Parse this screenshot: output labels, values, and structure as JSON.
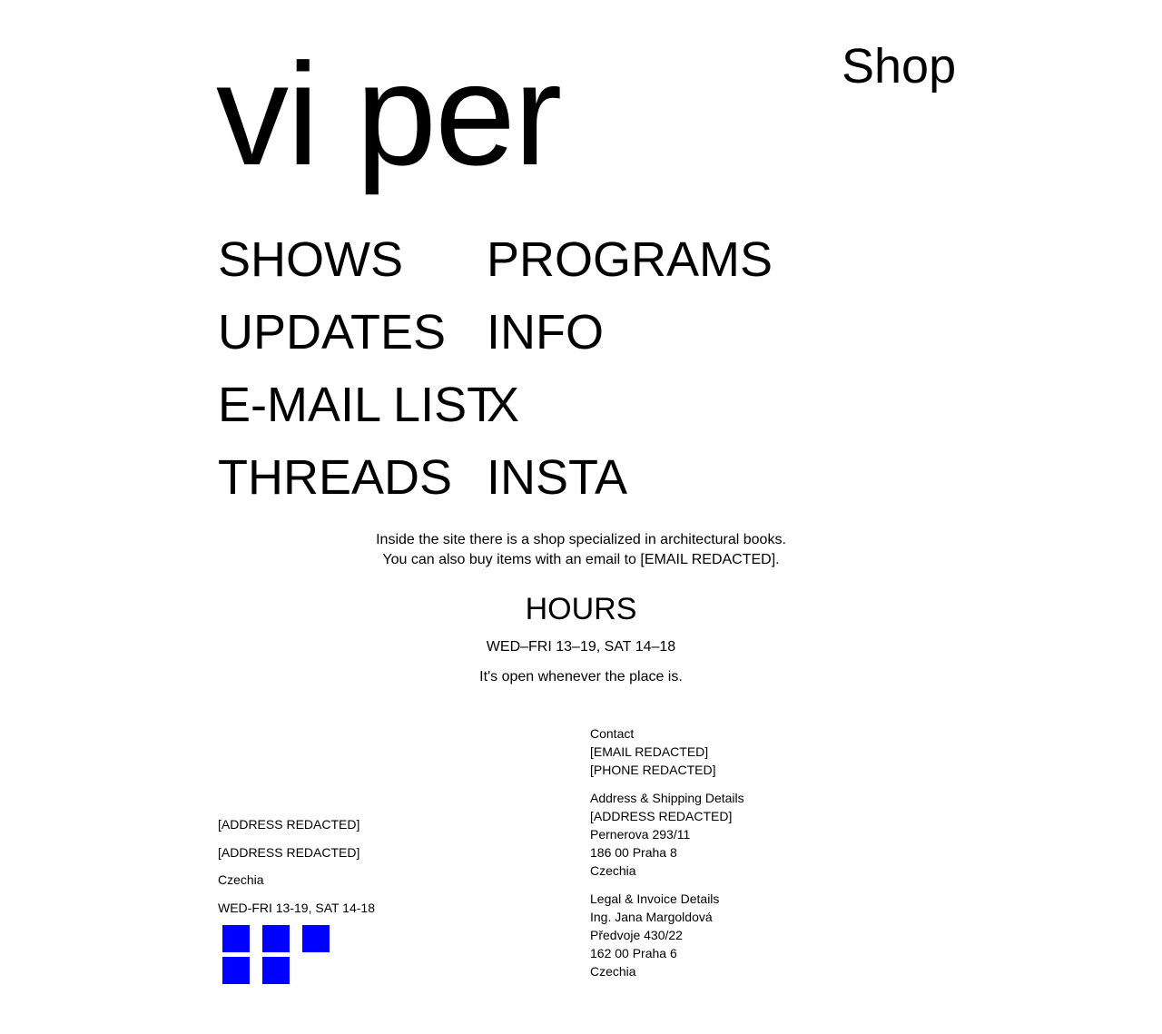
{
  "header": {
    "logo": "vi per",
    "shop_label": "Shop"
  },
  "nav": {
    "items": [
      "SHOWS",
      "PROGRAMS",
      "UPDATES",
      "INFO",
      "E-MAIL LIST",
      "X",
      "THREADS",
      "INSTA"
    ]
  },
  "intro": {
    "line1": "Inside the site there is a shop specialized in architectural books.",
    "line2": "You can also buy items with an email to [EMAIL REDACTED]."
  },
  "hours": {
    "title": "HOURS",
    "times": "WED–FRI 13–19, SAT 14–18",
    "note": "It's open whenever the place is."
  },
  "footer_left": {
    "lines": [
      "[ADDRESS REDACTED]",
      "[ADDRESS REDACTED]",
      "Czechia",
      "WED-FRI 13-19, SAT 14-18"
    ],
    "icon_color": "#0000ff",
    "icons": [
      "social-icon-1",
      "social-icon-2",
      "social-icon-3",
      "social-icon-4",
      "social-icon-5"
    ]
  },
  "footer_right": {
    "contact": {
      "heading": "Contact",
      "email": "[EMAIL REDACTED]",
      "phone": "[PHONE REDACTED]"
    },
    "shipping": {
      "heading": "Address & Shipping Details",
      "lines": [
        "[ADDRESS REDACTED]",
        "Pernerova 293/11",
        "186 00 Praha 8",
        "Czechia"
      ]
    },
    "legal": {
      "heading": "Legal & Invoice Details",
      "lines": [
        "Ing. Jana Margoldová",
        "Předvoje 430/22",
        "162 00 Praha 6",
        "Czechia"
      ]
    }
  }
}
